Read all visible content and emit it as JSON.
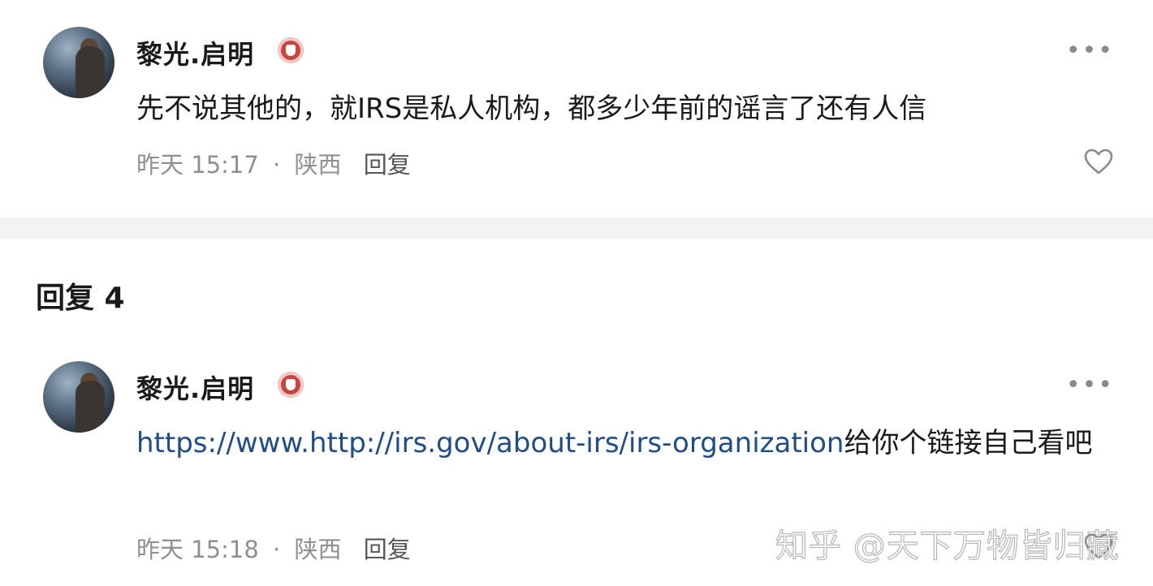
{
  "comments": [
    {
      "username": "黎光.启明",
      "badge_icon": "creator-badge-icon",
      "more_icon": "more-dots-icon",
      "text_plain": "先不说其他的，就IRS是私人机构，都多少年前的谣言了还有人信",
      "time": "昨天 15:17",
      "separator": "·",
      "location": "陕西",
      "reply_label": "回复",
      "like_icon": "heart-outline-icon"
    },
    {
      "username": "黎光.启明",
      "badge_icon": "creator-badge-icon",
      "more_icon": "more-dots-icon",
      "text_link": "https://www.http://irs.gov/about-irs/irs-organization",
      "text_after_link": "给你个链接自己看吧",
      "time": "昨天 15:18",
      "separator": "·",
      "location": "陕西",
      "reply_label": "回复",
      "like_icon": "heart-outline-icon"
    }
  ],
  "replies_section": {
    "title": "回复 4"
  },
  "watermark": "知乎 @天下万物皆归藏",
  "colors": {
    "link": "#1e4c8c",
    "badge": "#c9453e",
    "meta": "#8f8f8f",
    "divider": "#f3f3f3"
  }
}
